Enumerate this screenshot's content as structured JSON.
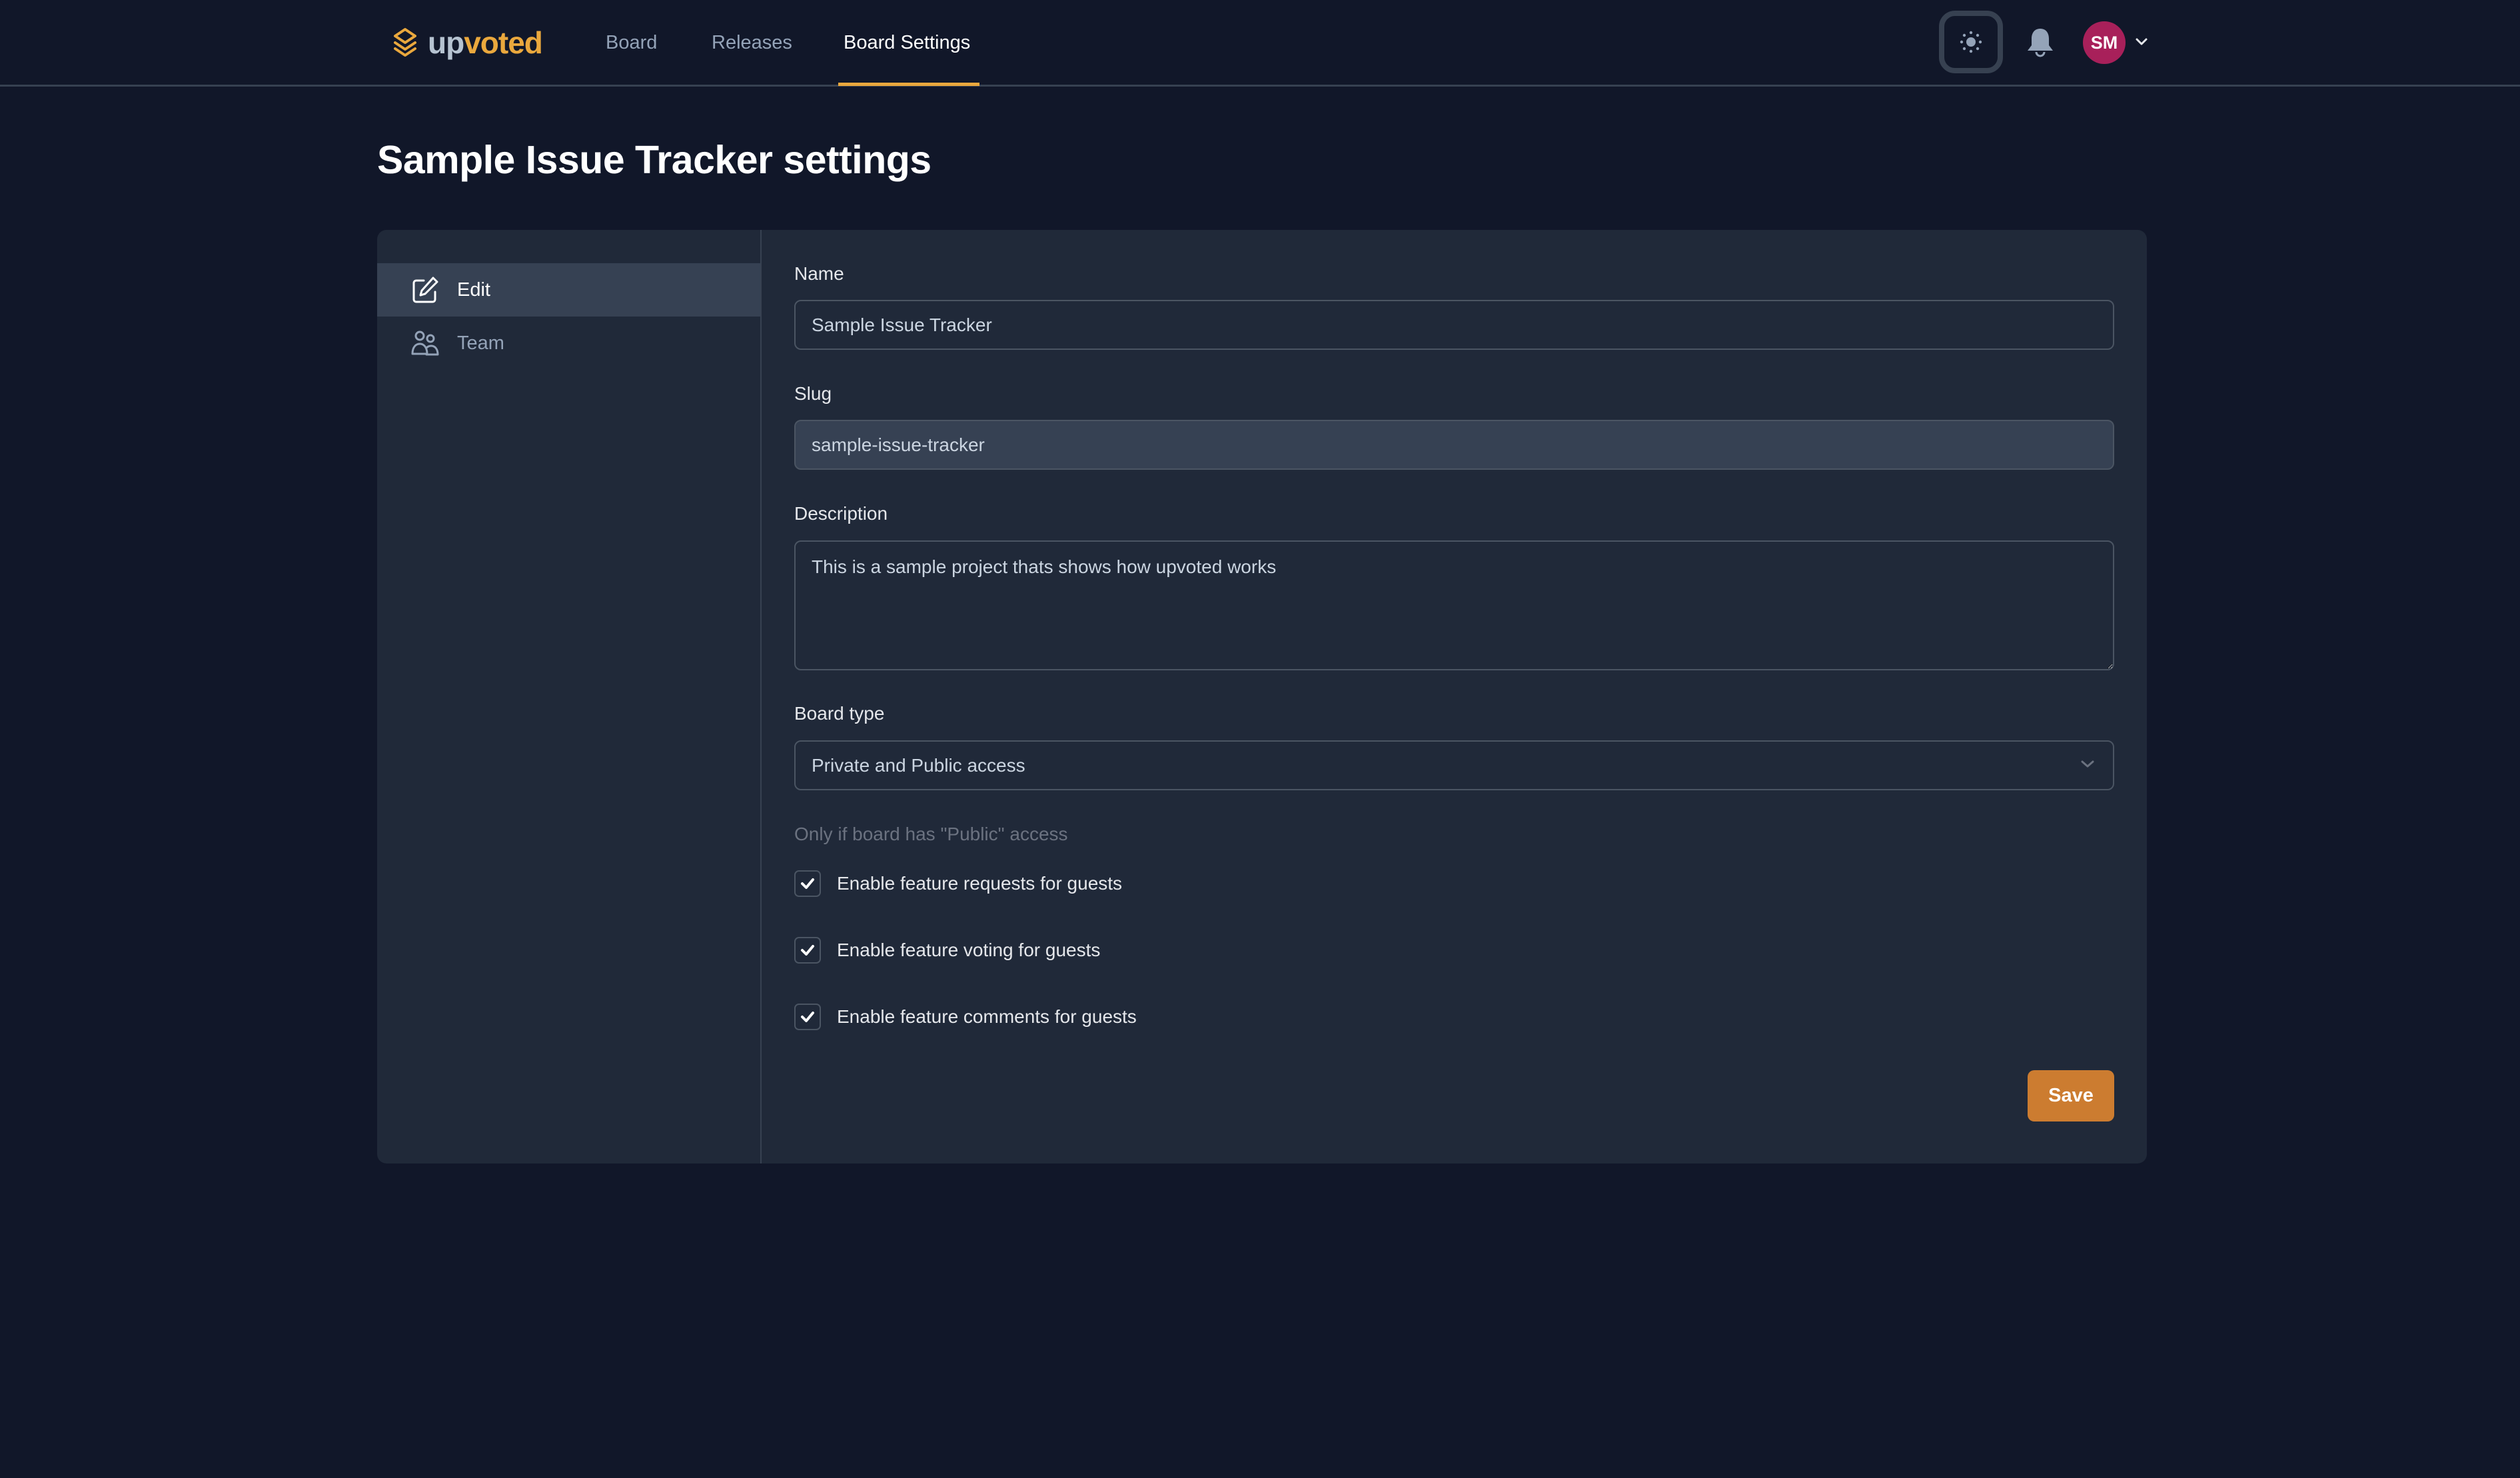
{
  "header": {
    "logo": {
      "part1": "up",
      "part2": "voted",
      "icon": "stacked-layers-icon"
    },
    "nav": [
      {
        "label": "Board",
        "active": false
      },
      {
        "label": "Releases",
        "active": false
      },
      {
        "label": "Board Settings",
        "active": true
      }
    ],
    "theme_toggle_icon": "sun-icon",
    "notifications_icon": "bell-icon",
    "user": {
      "initials": "SM",
      "avatar_color": "#a8205a"
    }
  },
  "page": {
    "title": "Sample Issue Tracker settings"
  },
  "sidebar": {
    "items": [
      {
        "label": "Edit",
        "icon": "edit-icon",
        "active": true
      },
      {
        "label": "Team",
        "icon": "users-icon",
        "active": false
      }
    ]
  },
  "form": {
    "name": {
      "label": "Name",
      "value": "Sample Issue Tracker"
    },
    "slug": {
      "label": "Slug",
      "value": "sample-issue-tracker"
    },
    "description": {
      "label": "Description",
      "value": "This is a sample project thats shows how upvoted works"
    },
    "board_type": {
      "label": "Board type",
      "selected": "Private and Public access"
    },
    "public_note": "Only if board has \"Public\" access",
    "checkboxes": [
      {
        "label": "Enable feature requests for guests",
        "checked": true
      },
      {
        "label": "Enable feature voting for guests",
        "checked": true
      },
      {
        "label": "Enable feature comments for guests",
        "checked": true
      }
    ],
    "save_label": "Save"
  },
  "colors": {
    "background": "#111729",
    "card": "#202939",
    "accent": "#eaa83d",
    "button": "#cc7c30"
  }
}
